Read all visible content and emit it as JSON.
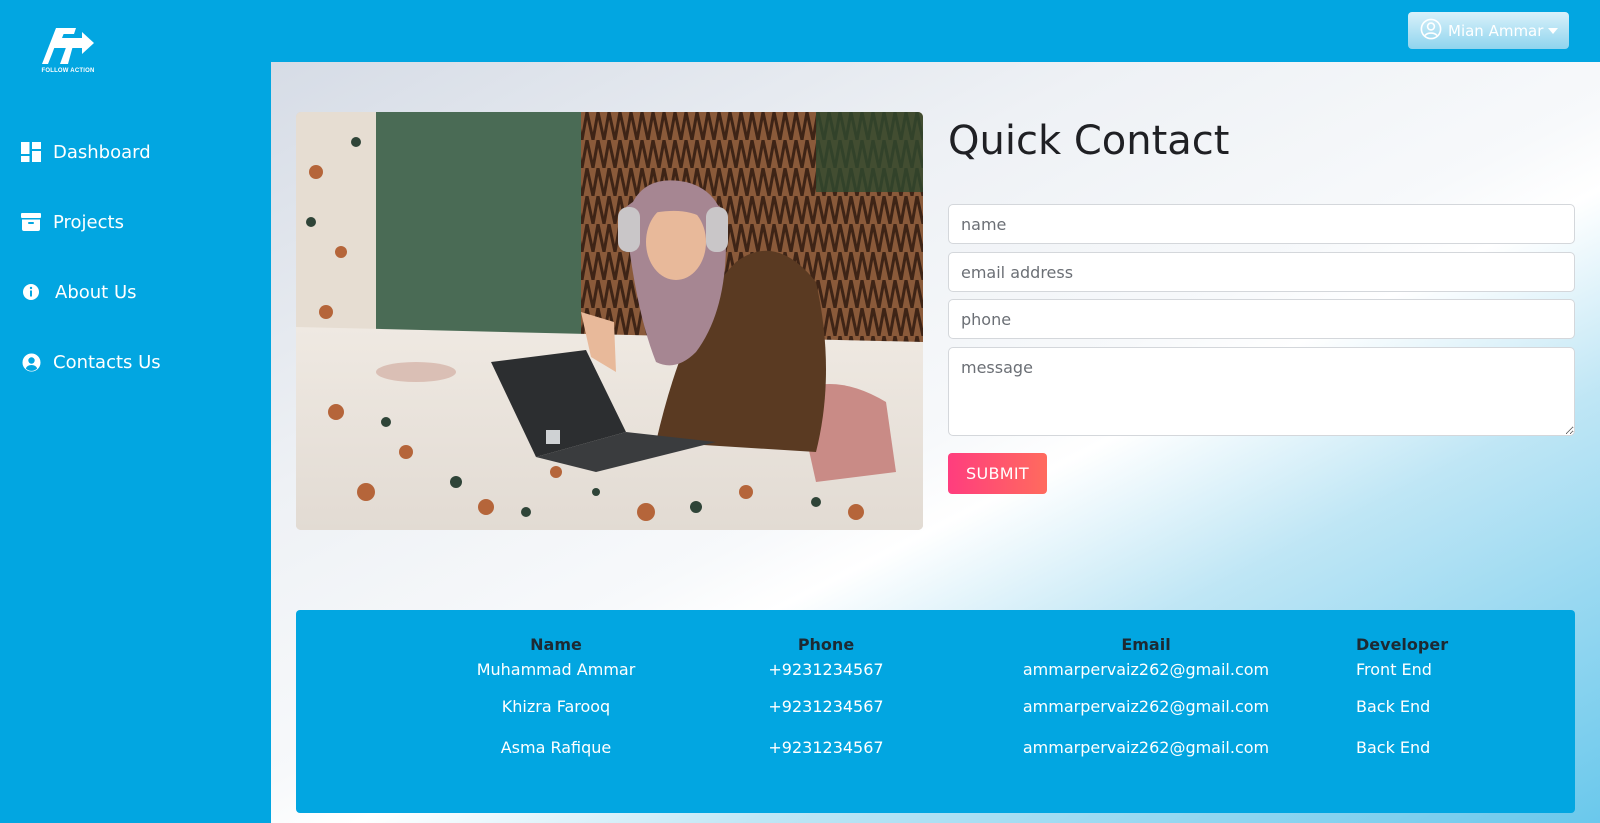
{
  "brand": {
    "logo_text": "FOLLOW ACTION"
  },
  "sidebar": {
    "items": [
      {
        "label": "Dashboard",
        "icon": "dashboard-icon"
      },
      {
        "label": "Projects",
        "icon": "archive-icon"
      },
      {
        "label": "About Us",
        "icon": "info-icon"
      },
      {
        "label": "Contacts Us",
        "icon": "user-circle-icon"
      }
    ]
  },
  "header": {
    "user_name": "Mian Ammar",
    "user_icon": "user-circle-icon"
  },
  "contact": {
    "title": "Quick Contact",
    "name_placeholder": "name",
    "email_placeholder": "email address",
    "phone_placeholder": "phone",
    "message_placeholder": "message",
    "submit_label": "SUBMIT"
  },
  "team": {
    "headers": [
      "Name",
      "Phone",
      "Email",
      "Developer"
    ],
    "rows": [
      [
        "Muhammad Ammar",
        "+9231234567",
        "ammarpervaiz262@gmail.com",
        "Front End"
      ],
      [
        "Khizra Farooq",
        "+9231234567",
        "ammarpervaiz262@gmail.com",
        "Back End"
      ],
      [
        "Asma Rafique",
        "+9231234567",
        "ammarpervaiz262@gmail.com",
        "Back End"
      ]
    ]
  },
  "colors": {
    "primary": "#02a6e1",
    "submit_gradient_start": "#ff3d7e",
    "submit_gradient_end": "#ff6b5e"
  }
}
